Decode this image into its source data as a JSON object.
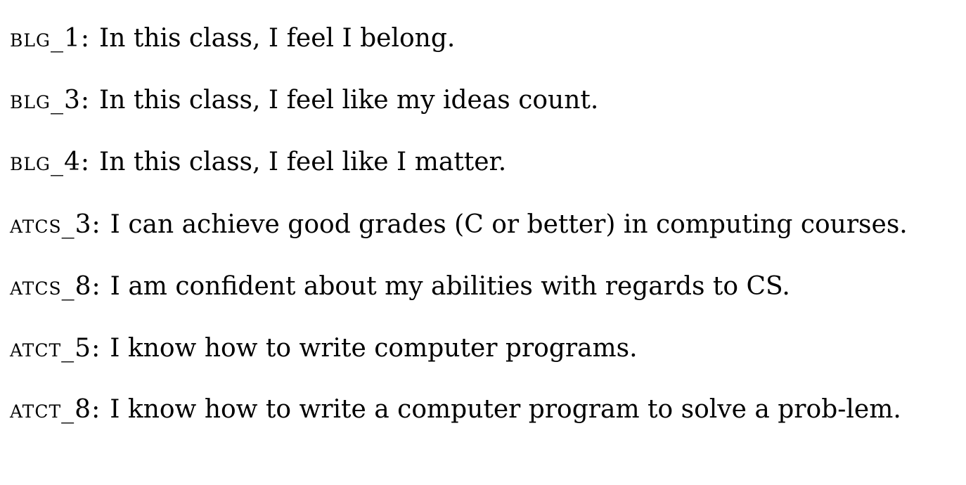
{
  "items": [
    {
      "label": "BLG_1",
      "colon": ":",
      "text": "In this class, I feel I belong."
    },
    {
      "label": "BLG_3",
      "colon": ":",
      "text": "In this class, I feel like my ideas count."
    },
    {
      "label": "BLG_4",
      "colon": ":",
      "text": "In this class, I feel like I matter."
    },
    {
      "label": "ATCS_3",
      "colon": ":",
      "text": "I can achieve good grades (C or better) in computing courses."
    },
    {
      "label": "ATCS_8",
      "colon": ":",
      "text": "I am confident about my abilities with regards to CS."
    },
    {
      "label": "ATCT_5",
      "colon": ":",
      "text": "I know how to write computer programs."
    },
    {
      "label": "ATCT_8",
      "colon": ":",
      "text": "I know how to write a computer program to solve a prob-lem."
    }
  ]
}
